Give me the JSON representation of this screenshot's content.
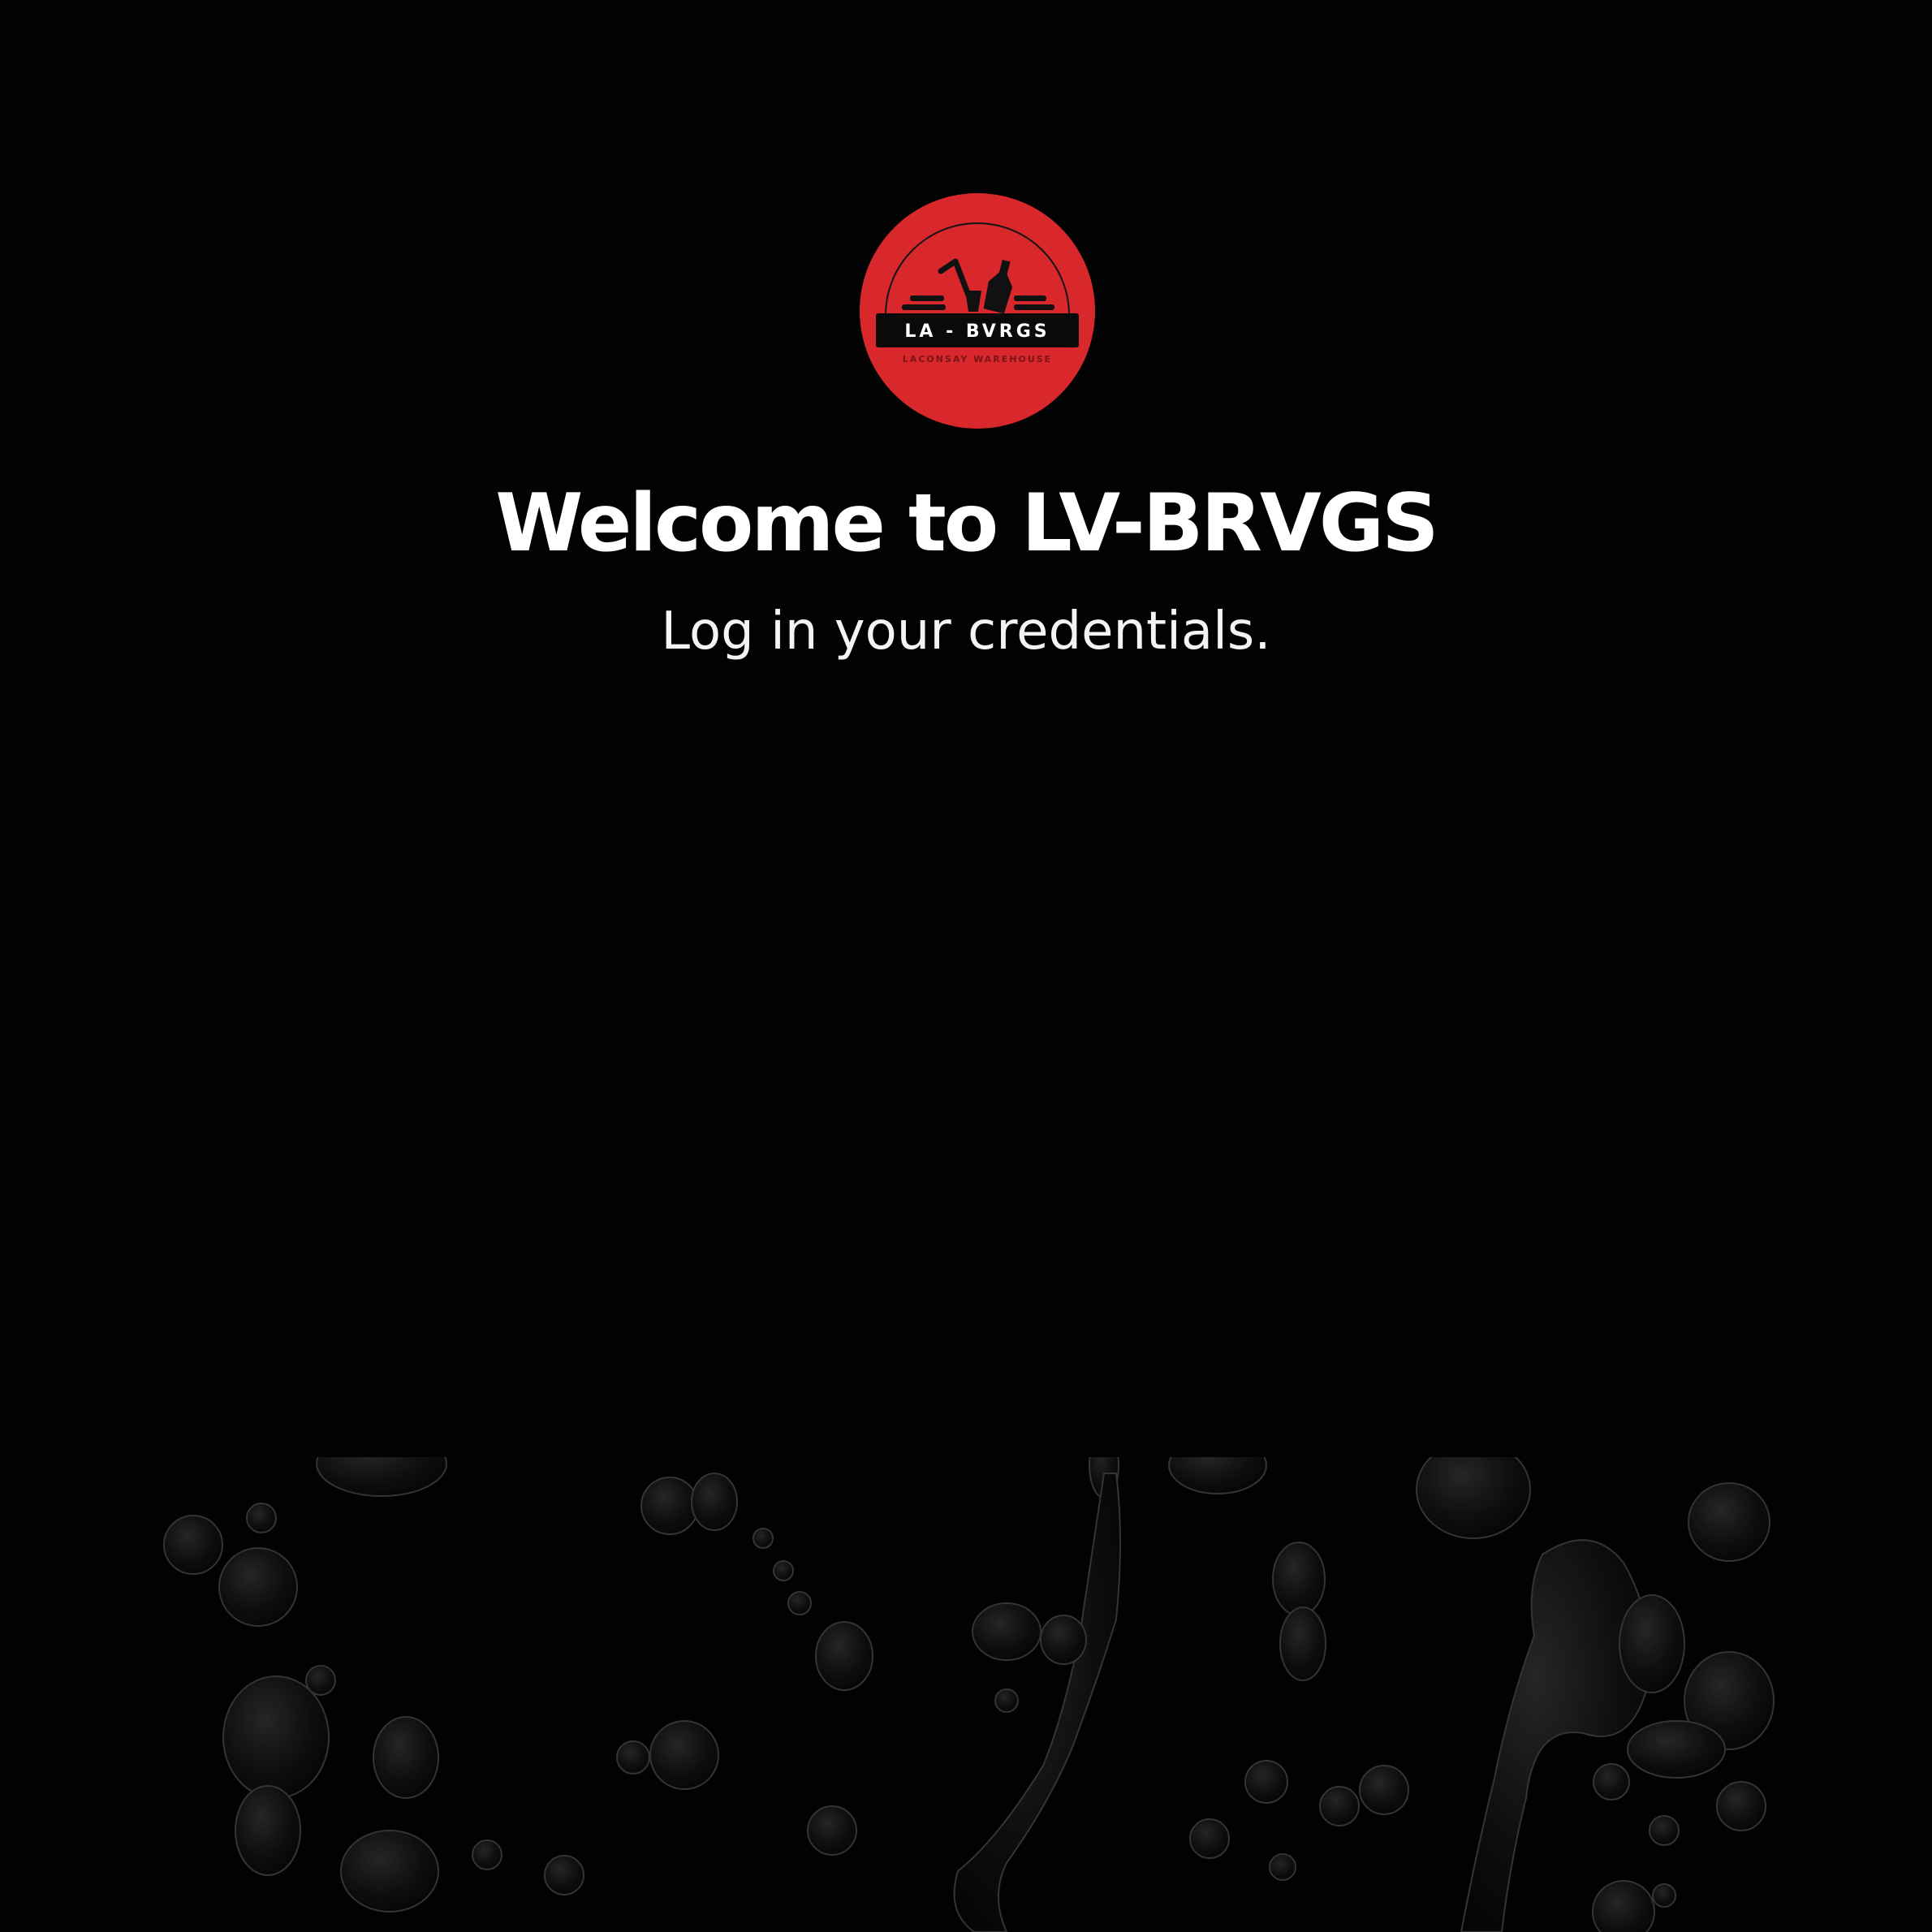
{
  "logo": {
    "brand_text": "LA - BVRGS",
    "tagline": "LACONSAY WAREHOUSE",
    "circle_color": "#d8282c",
    "band_color": "#0a0a0a"
  },
  "header": {
    "title": "Welcome to LV-BRVGS",
    "subtitle": "Log in your credentials."
  },
  "background": {
    "decoration": "liquid-splash",
    "base_color": "#020203"
  }
}
